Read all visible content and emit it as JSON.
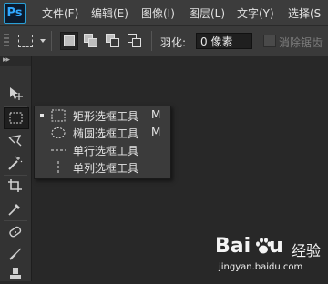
{
  "app": {
    "logo": "Ps"
  },
  "menu": [
    "文件(F)",
    "编辑(E)",
    "图像(I)",
    "图层(L)",
    "文字(Y)",
    "选择(S"
  ],
  "options": {
    "feather_label": "羽化:",
    "feather_value": "0 像素",
    "antialias_label": "消除锯齿",
    "antialias_checked": false
  },
  "flyout": {
    "items": [
      {
        "label": "矩形选框工具",
        "shortcut": "M",
        "selected": true,
        "icon": "rect-marquee-icon"
      },
      {
        "label": "椭圆选框工具",
        "shortcut": "M",
        "selected": false,
        "icon": "ellipse-marquee-icon"
      },
      {
        "label": "单行选框工具",
        "shortcut": "",
        "selected": false,
        "icon": "single-row-marquee-icon"
      },
      {
        "label": "单列选框工具",
        "shortcut": "",
        "selected": false,
        "icon": "single-column-marquee-icon"
      }
    ]
  },
  "watermark": {
    "brand": "Bai",
    "brand_suffix": "u",
    "jingyan": "经验",
    "url": "jingyan.baidu.com"
  },
  "colors": {
    "menubar": "#3c3c3c",
    "toolbar": "#333333",
    "flyout": "#3b3b3b",
    "canvas": "#282828"
  }
}
